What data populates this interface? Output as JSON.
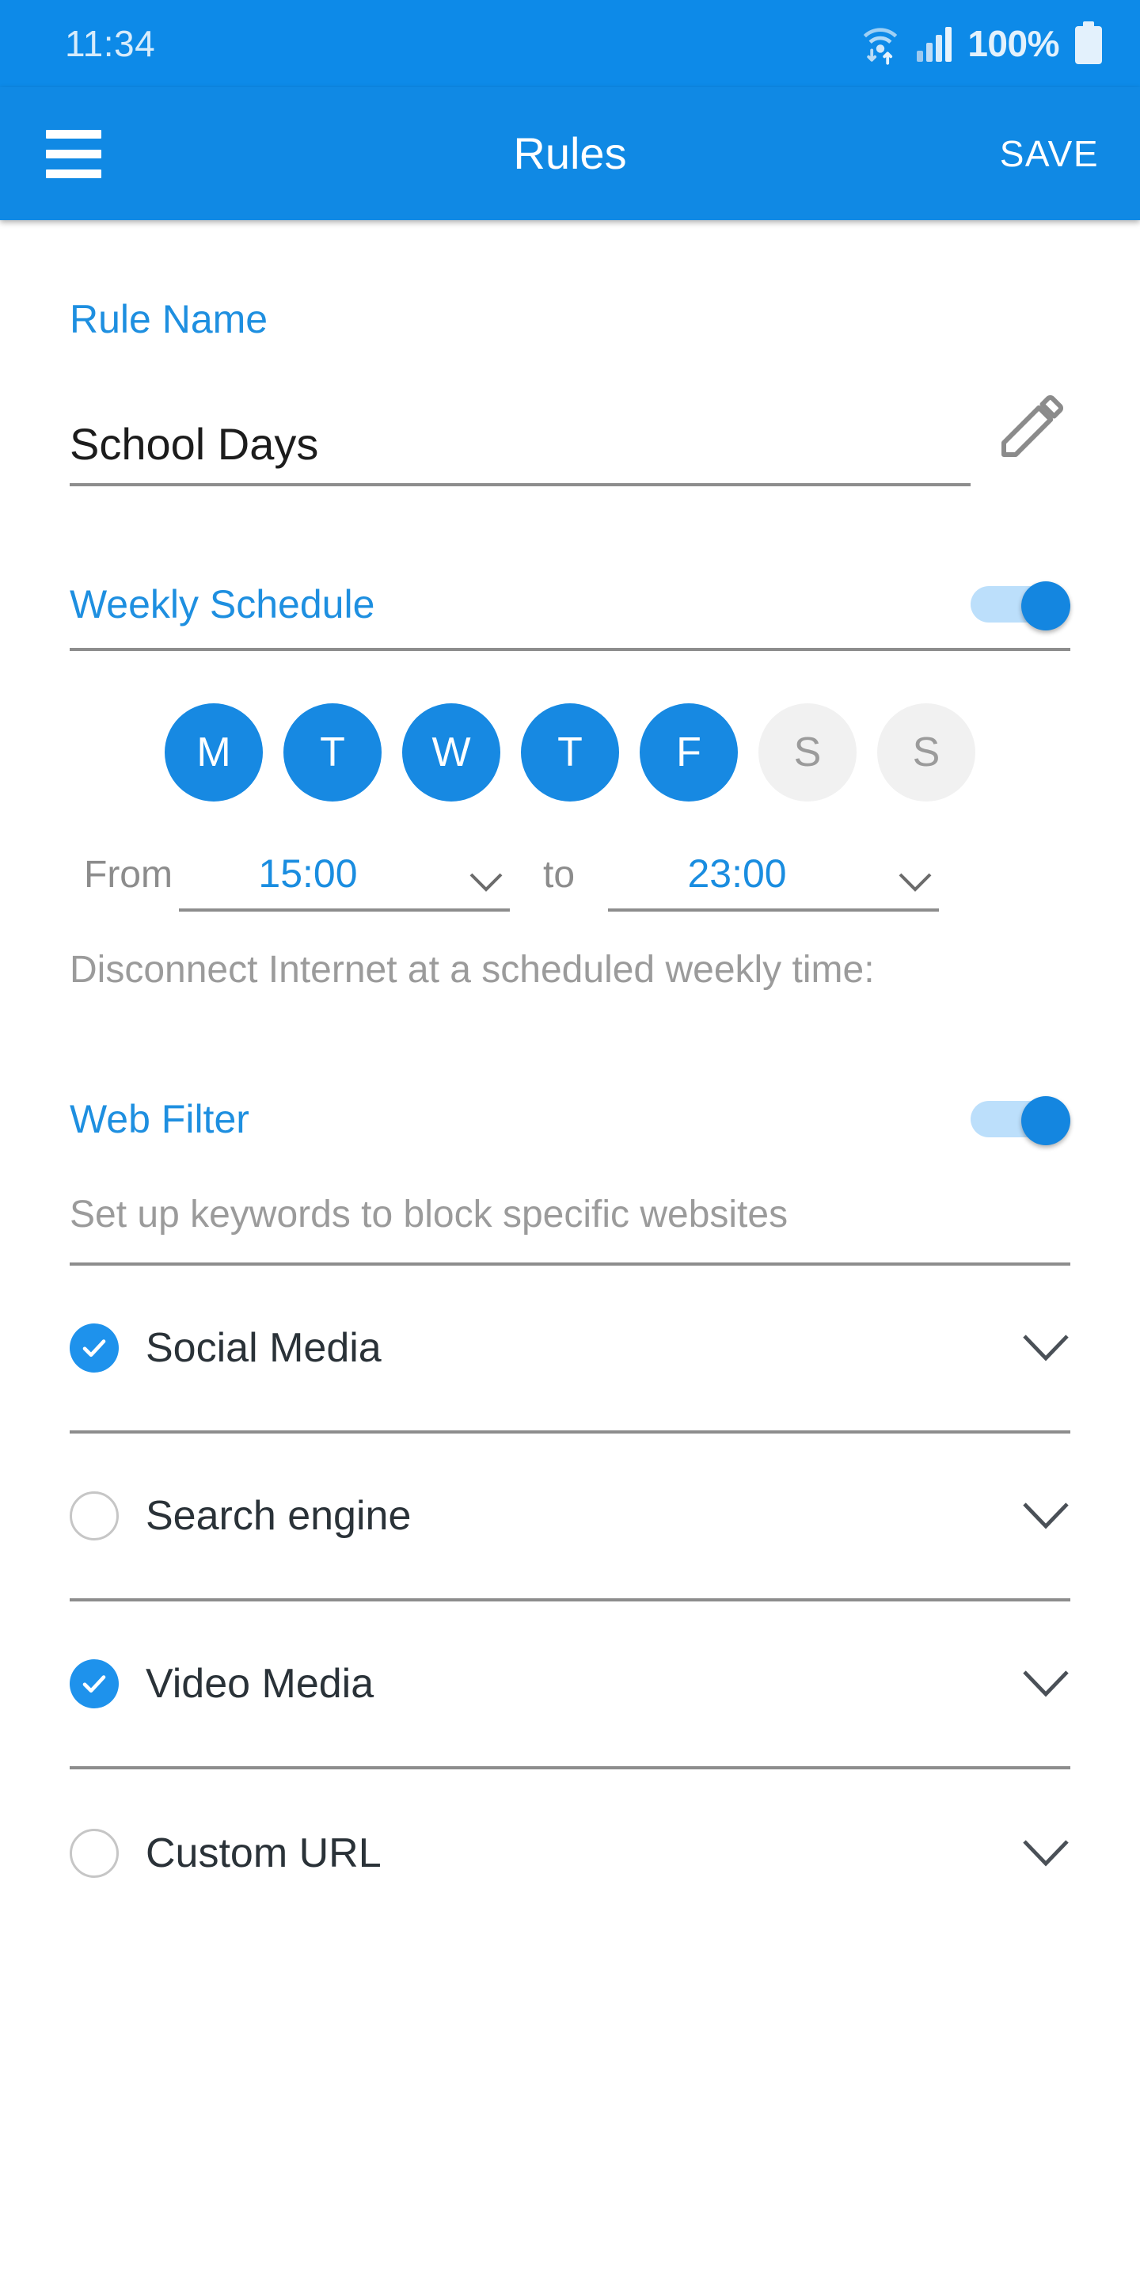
{
  "status_bar": {
    "time": "11:34",
    "battery_percent": "100%",
    "icons": [
      "wifi-data-icon",
      "signal-bars-icon",
      "battery-icon"
    ],
    "background_color": "#0d8ae8",
    "text_color": "#d7ecfb"
  },
  "app_bar": {
    "menu_icon": "hamburger-menu-icon",
    "title": "Rules",
    "save_label": "SAVE",
    "background_color": "#1089e4"
  },
  "rule_name": {
    "label": "Rule Name",
    "value": "School Days",
    "placeholder": "Rule Name",
    "edit_icon": "pencil-icon"
  },
  "weekly_schedule": {
    "label": "Weekly Schedule",
    "enabled": true,
    "days": [
      {
        "letter": "M",
        "name": "Monday",
        "selected": true
      },
      {
        "letter": "T",
        "name": "Tuesday",
        "selected": true
      },
      {
        "letter": "W",
        "name": "Wednesday",
        "selected": true
      },
      {
        "letter": "T",
        "name": "Thursday",
        "selected": true
      },
      {
        "letter": "F",
        "name": "Friday",
        "selected": true
      },
      {
        "letter": "S",
        "name": "Saturday",
        "selected": false
      },
      {
        "letter": "S",
        "name": "Sunday",
        "selected": false
      }
    ],
    "from_label": "From",
    "from_time": "15:00",
    "to_label": "to",
    "to_time": "23:00",
    "hint": "Disconnect Internet at a scheduled weekly time:"
  },
  "web_filter": {
    "label": "Web Filter",
    "enabled": true,
    "description": "Set up keywords to block specific websites",
    "items": [
      {
        "label": "Social Media",
        "checked": true
      },
      {
        "label": "Search engine",
        "checked": false
      },
      {
        "label": "Video Media",
        "checked": true
      },
      {
        "label": "Custom URL",
        "checked": false
      }
    ]
  },
  "colors": {
    "accent": "#1789e2",
    "label_blue": "#1e8fe0",
    "muted_gray": "#9b9b9b",
    "divider": "#8d8d8d"
  }
}
